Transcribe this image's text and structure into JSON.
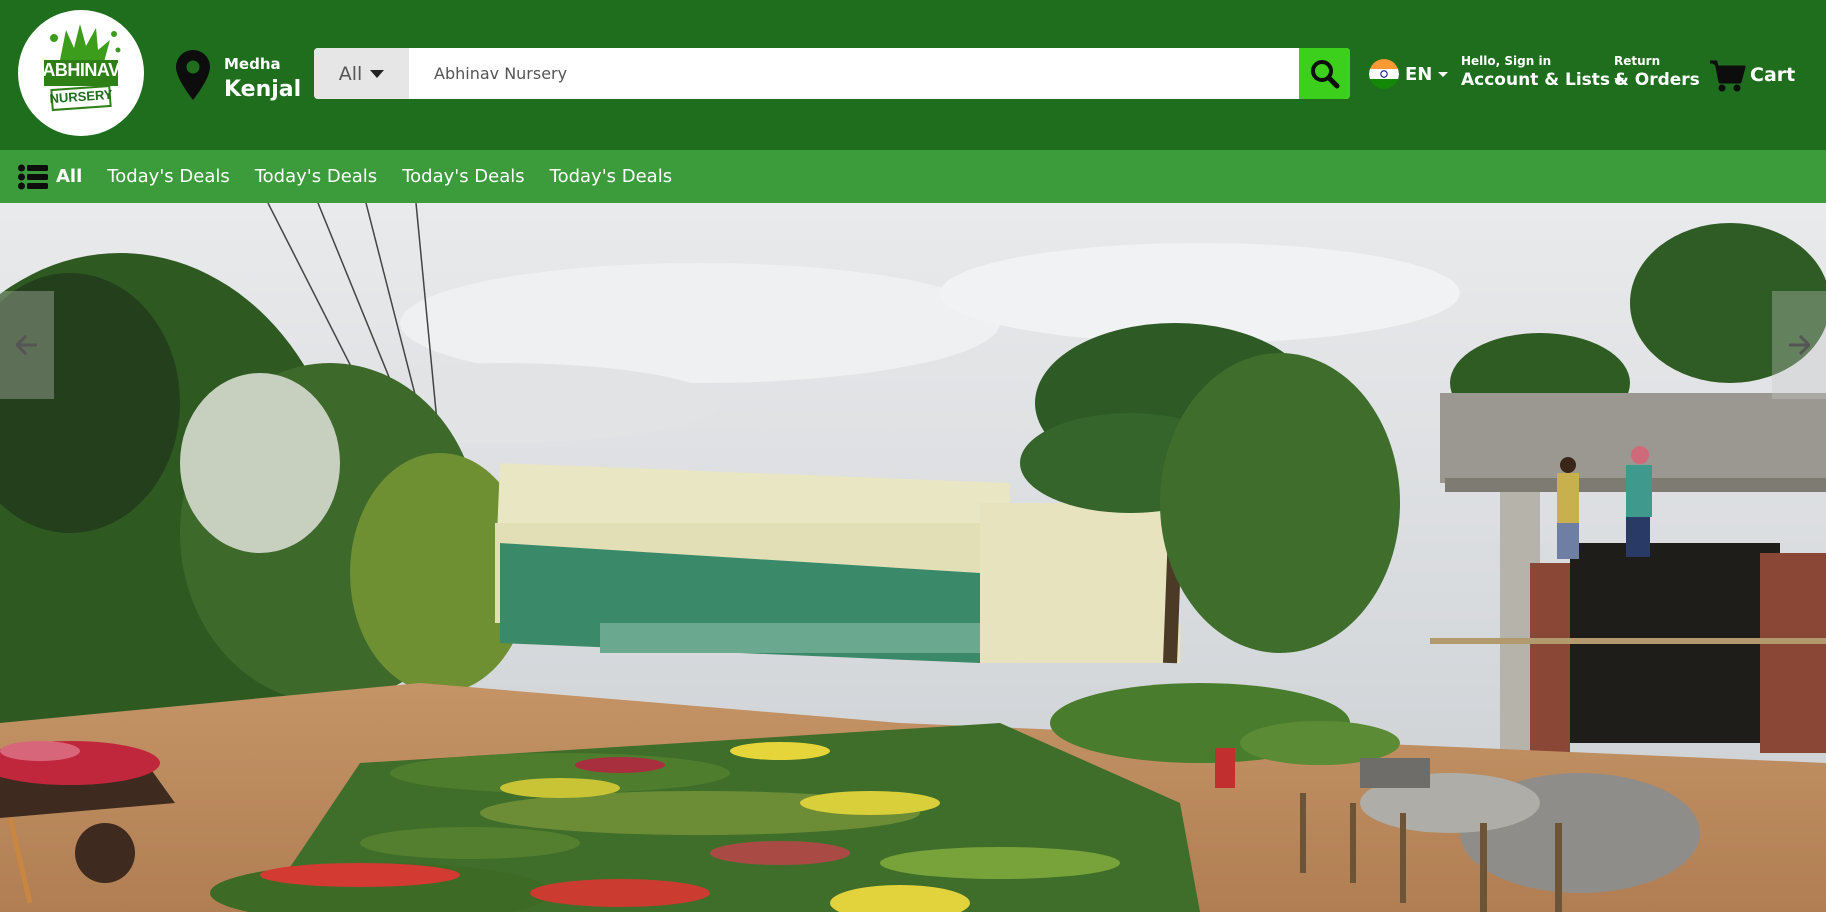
{
  "brand": {
    "logo_line1": "ABHINAV",
    "logo_line2": "NURSERY"
  },
  "location": {
    "line1": "Medha",
    "line2": "Kenjal",
    "icon": "location-pin-icon"
  },
  "search": {
    "category": "All",
    "placeholder": "Abhinav Nursery",
    "icon": "search-icon"
  },
  "language": {
    "code": "EN",
    "flag": "india-flag-icon"
  },
  "account": {
    "line1": "Hello, Sign in",
    "line2": "Account & Lists"
  },
  "orders": {
    "line1": "Return",
    "line2": "& Orders"
  },
  "cart": {
    "label": "Cart",
    "icon": "cart-icon"
  },
  "nav": {
    "all_label": "All",
    "links": [
      "Today's Deals",
      "Today's Deals",
      "Today's Deals",
      "Today's Deals"
    ]
  },
  "carousel": {
    "prev_icon": "arrow-left-icon",
    "next_icon": "arrow-right-icon"
  },
  "colors": {
    "header": "#1e6e1e",
    "nav": "#3c9c3c",
    "search_button": "#3ccf1c"
  }
}
